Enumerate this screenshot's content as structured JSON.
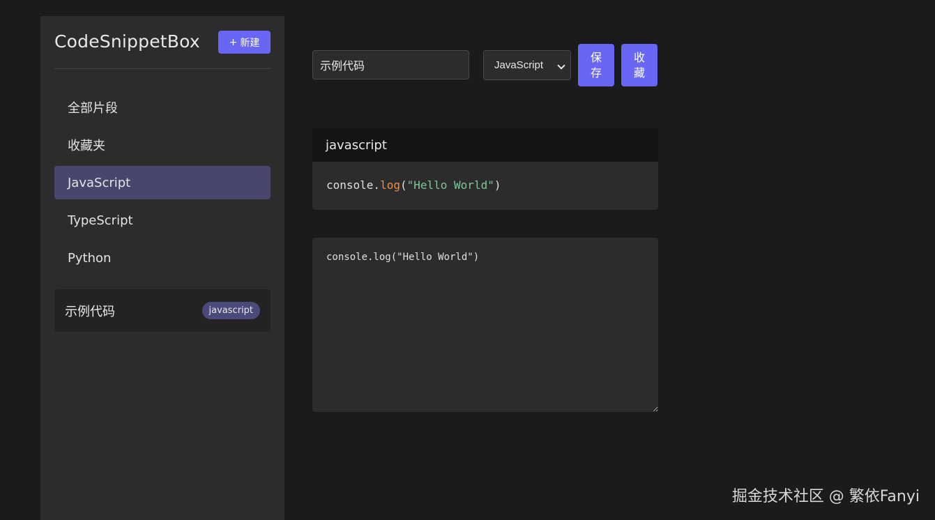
{
  "sidebar": {
    "app_title": "CodeSnippetBox",
    "new_button_icon": "+",
    "new_button_label": "新建",
    "nav_items": [
      {
        "label": "全部片段",
        "active": false
      },
      {
        "label": "收藏夹",
        "active": false
      },
      {
        "label": "JavaScript",
        "active": true
      },
      {
        "label": "TypeScript",
        "active": false
      },
      {
        "label": "Python",
        "active": false
      }
    ],
    "snippets": [
      {
        "title": "示例代码",
        "tag": "javascript"
      }
    ]
  },
  "toolbar": {
    "title_value": "示例代码",
    "language_selected": "JavaScript",
    "save_label": "保存",
    "save_line1": "保",
    "save_line2": "存",
    "favorite_label": "收藏",
    "favorite_line1": "收",
    "favorite_line2": "藏"
  },
  "preview": {
    "language": "javascript",
    "code_obj": "console.",
    "code_fn": "log",
    "code_open": "(",
    "code_str": "\"Hello World\"",
    "code_close": ")"
  },
  "editor": {
    "value": "console.log(\"Hello World\")"
  },
  "watermark": "掘金技术社区 @ 繁依Fanyi",
  "colors": {
    "accent": "#6a66f5",
    "active_nav": "#47466c",
    "background": "#1b1b1b",
    "panel": "#2c2c2c"
  }
}
